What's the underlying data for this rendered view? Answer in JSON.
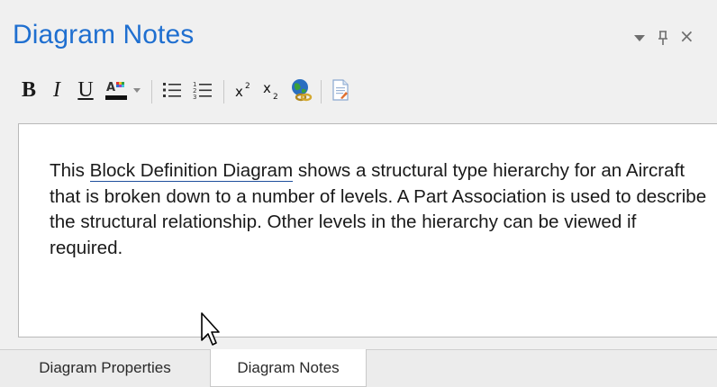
{
  "panel": {
    "title": "Diagram Notes"
  },
  "title_controls": {
    "dropdown_icon": "chevron-down-icon",
    "pin_icon": "pin-icon",
    "close_icon": "close-icon",
    "close_glyph": "×"
  },
  "toolbar": {
    "bold": "B",
    "italic": "I",
    "underline": "U",
    "font_color_icon": "text-color-icon",
    "font_color_dropdown_icon": "chevron-down-icon",
    "bullet_list_icon": "bullet-list-icon",
    "numbered_list_icon": "numbered-list-icon",
    "superscript_icon": "superscript-icon",
    "subscript_icon": "subscript-icon",
    "hyperlink_icon": "hyperlink-globe-icon",
    "insert_doc_icon": "document-icon"
  },
  "notes": {
    "prefix": "This ",
    "link_text": "Block Definition Diagram",
    "suffix": " shows a structural type hierarchy for an Aircraft that is broken down to a number of levels.  A Part Association is used to describe the structural relationship. Other levels in the hierarchy can be viewed if required."
  },
  "tabs": [
    {
      "label": "Diagram Properties",
      "active": false
    },
    {
      "label": "Diagram Notes",
      "active": true
    }
  ],
  "colors": {
    "title": "#1f6fd0",
    "background": "#f0f0f0",
    "editor": "#ffffff",
    "link_underline": "#1f4f9c"
  }
}
